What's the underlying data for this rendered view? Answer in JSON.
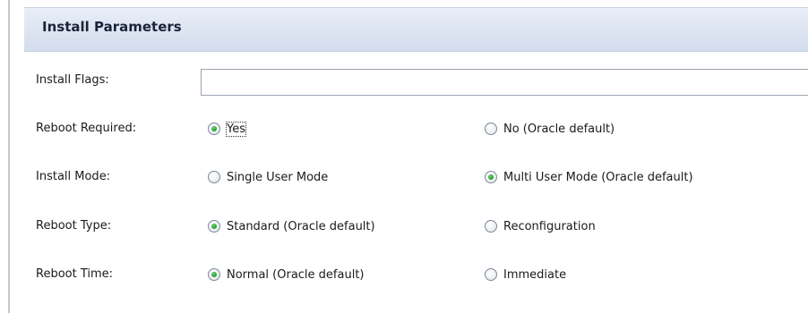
{
  "section": {
    "title": "Install Parameters"
  },
  "fields": {
    "install_flags": {
      "label": "Install Flags:",
      "value": "",
      "placeholder": ""
    },
    "reboot_required": {
      "label": "Reboot Required:",
      "options": [
        "Yes",
        "No (Oracle default)"
      ],
      "selected": "Yes"
    },
    "install_mode": {
      "label": "Install Mode:",
      "options": [
        "Single User Mode",
        "Multi User Mode (Oracle default)"
      ],
      "selected": "Multi User Mode (Oracle default)"
    },
    "reboot_type": {
      "label": "Reboot Type:",
      "options": [
        "Standard (Oracle default)",
        "Reconfiguration"
      ],
      "selected": "Standard (Oracle default)"
    },
    "reboot_time": {
      "label": "Reboot Time:",
      "options": [
        "Normal (Oracle default)",
        "Immediate"
      ],
      "selected": "Normal (Oracle default)"
    }
  },
  "colors": {
    "header_bg_top": "#e9eef7",
    "header_bg_bottom": "#d3dced",
    "radio_selected": "#1f9a2c",
    "input_border": "#9aa4b4"
  },
  "icons": {
    "radio_checked": "radio-checked-icon",
    "radio_unchecked": "radio-unchecked-icon"
  }
}
